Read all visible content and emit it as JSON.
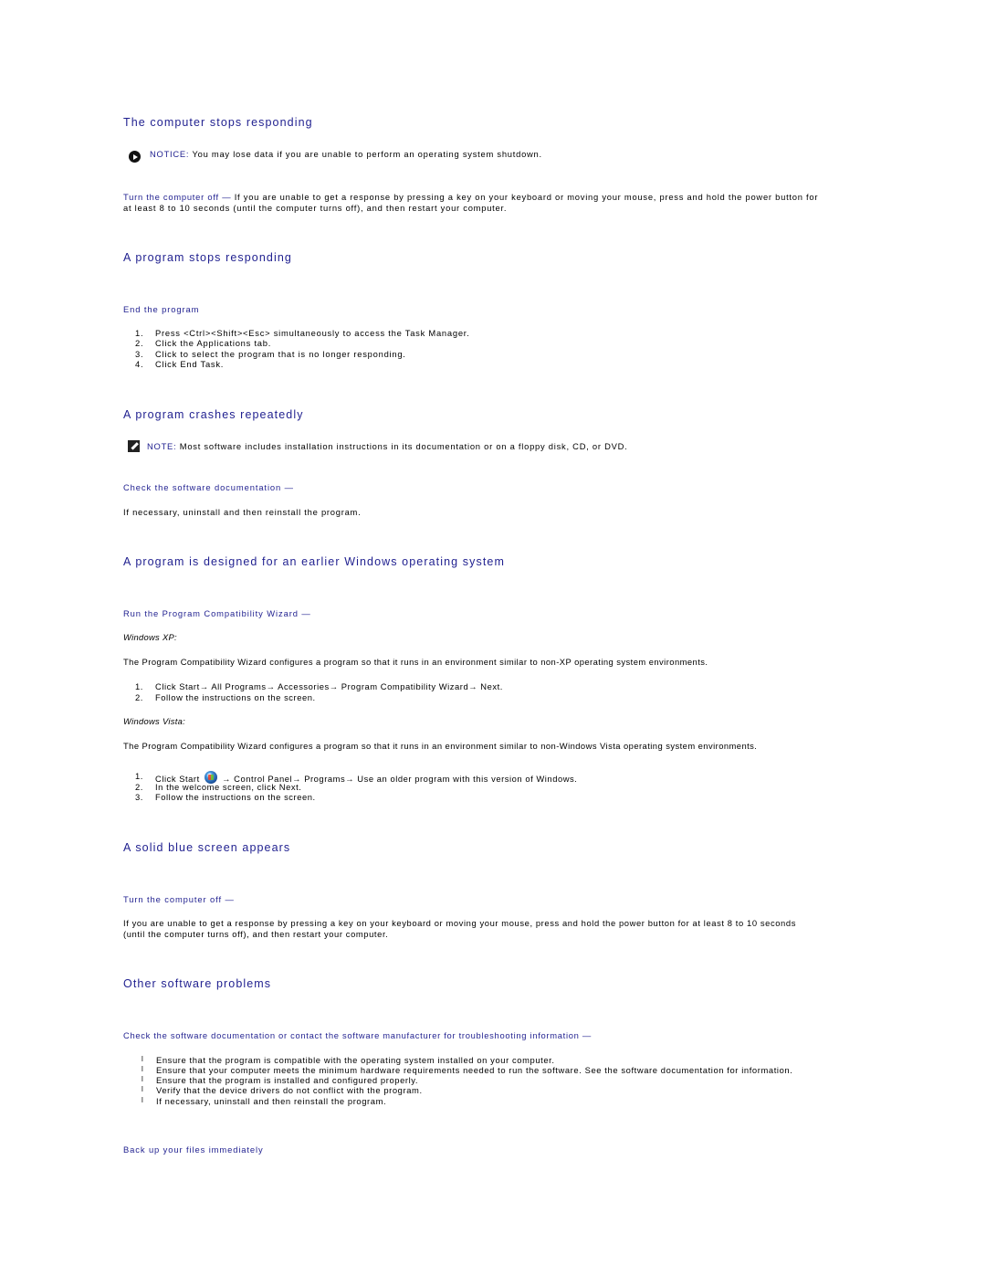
{
  "sections": {
    "stops": {
      "title": "The computer stops responding",
      "notice_label": "NOTICE:",
      "notice_text": " You may lose data if you are unable to perform an operating system shutdown.",
      "action_label": "Turn the computer off",
      "action_dash": " — ",
      "action_text_1": "If you are unable to get a response by pressing a key on your keyboard or moving your mouse, press and hold the power button for",
      "action_text_2": "at least 8 to 10 seconds (until the computer turns off), and then restart your computer."
    },
    "program_stops": {
      "title": "A program stops responding",
      "subheading": "End the program",
      "steps": [
        {
          "num": "1.",
          "text": "Press <Ctrl><Shift><Esc> simultaneously to access the Task Manager."
        },
        {
          "num": "2.",
          "text": "Click the Applications tab."
        },
        {
          "num": "3.",
          "text": "Click to select the program that is no longer responding."
        },
        {
          "num": "4.",
          "text": "Click End Task."
        }
      ]
    },
    "crashes": {
      "title": "A program crashes repeatedly",
      "note_label": "NOTE:",
      "note_text": " Most software includes installation instructions in its documentation or on a floppy disk, CD, or DVD.",
      "subheading": "Check the software documentation",
      "dash": " —",
      "text": "If necessary, uninstall and then reinstall the program."
    },
    "earlier_windows": {
      "title": "A program is designed for an earlier Windows operating system",
      "subheading": "Run the Program Compatibility Wizard",
      "dash": " —",
      "xp_label": "Windows XP:",
      "xp_text": "The Program Compatibility Wizard configures a program so that it runs in an environment similar to non-XP operating system environments.",
      "xp_steps": [
        {
          "num": "1.",
          "text": "Click Start→ All Programs→ Accessories→ Program Compatibility Wizard→ Next."
        },
        {
          "num": "2.",
          "text": "Follow the instructions on the screen."
        }
      ],
      "vista_label": "Windows Vista:",
      "vista_text": "The Program Compatibility Wizard configures a program so that it runs in an environment similar to non-Windows Vista operating system environments.",
      "vista_step1_prefix": "Click Start",
      "vista_step1_suffix": " → Control Panel→ Programs→ Use an older program with this version of Windows.",
      "vista_steps": [
        {
          "num": "1."
        },
        {
          "num": "2.",
          "text": "In the welcome screen, click Next."
        },
        {
          "num": "3.",
          "text": "Follow the instructions on the screen."
        }
      ]
    },
    "blue_screen": {
      "title": "A solid blue screen appears",
      "subheading": "Turn the computer off",
      "dash": " —",
      "text_1": "If you are unable to get a response by pressing a key on your keyboard or moving your mouse, press and hold the power button for at least 8 to 10 seconds",
      "text_2": "(until the computer turns off), and then restart your computer."
    },
    "other": {
      "title": "Other software problems",
      "subheading": "Check the software documentation or contact the software manufacturer for troubleshooting information",
      "dash": " —",
      "bullet_glyph": "l",
      "bullets": [
        "Ensure that the program is compatible with the operating system installed on your computer.",
        "Ensure that your computer meets the minimum hardware requirements needed to run the software. See the software documentation for information.",
        "Ensure that the program is installed and configured properly.",
        "Verify that the device drivers do not conflict with the program.",
        "If necessary, uninstall and then reinstall the program."
      ],
      "footer_link": "Back up your files immediately"
    }
  },
  "colors": {
    "heading": "#1f1f8f",
    "body": "#000000",
    "background": "#ffffff"
  }
}
